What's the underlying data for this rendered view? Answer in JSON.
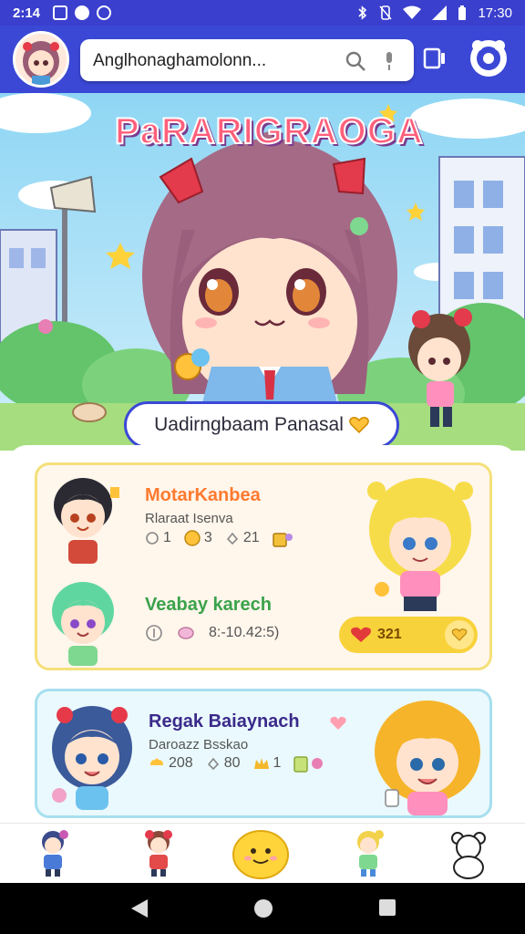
{
  "status_bar": {
    "time": "2:14",
    "clock": "17:30"
  },
  "search": {
    "query": "Anglhonaghamolonn..."
  },
  "hero": {
    "title": "PaRARIGRAOGA",
    "name_label": "Uadirngbaam Panasal"
  },
  "cards": [
    {
      "title": "MotarKanbea",
      "subtitle": "Rlaraat Isenva",
      "stats": [
        "1",
        "3",
        "21"
      ]
    },
    {
      "title": "Veabay karech",
      "stats_text": "8:-10.42:5)",
      "rating": "321"
    },
    {
      "title": "Regak Baiaynach",
      "subtitle": "Daroazz Bsskao",
      "stats": [
        "208",
        "80",
        "1"
      ]
    }
  ],
  "colors": {
    "accent": "#3b48d6",
    "status_bar": "#3a3fce",
    "card1_border": "#f4e07a",
    "card2_border": "#a7dfee",
    "rating_pill": "#f8d23a"
  }
}
